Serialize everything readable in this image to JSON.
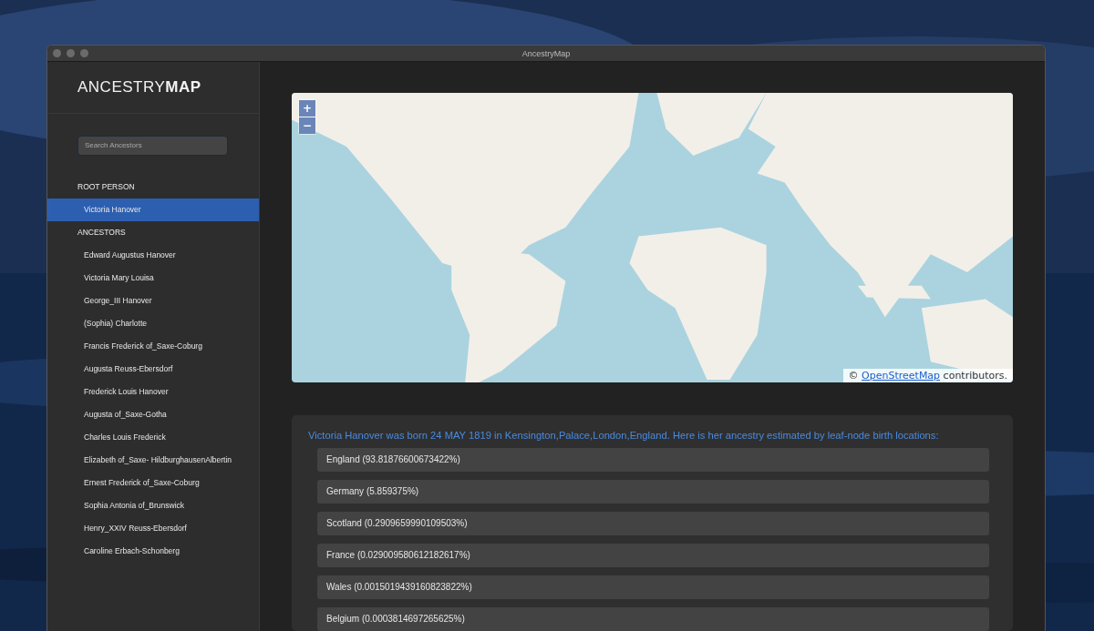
{
  "window": {
    "title": "AncestryMap"
  },
  "sidebar": {
    "logo": "ANCESTRY**MAP**",
    "search": {
      "placeholder": "Search Ancestors"
    },
    "sections": [
      {
        "heading": "ROOT PERSON",
        "items": [
          {
            "name": "Victoria Hanover",
            "selected": true
          }
        ]
      },
      {
        "heading": "ANCESTORS",
        "items": [
          {
            "name": "Edward Augustus Hanover",
            "selected": false
          },
          {
            "name": "Victoria Mary Louisa",
            "selected": false
          },
          {
            "name": "George_III Hanover",
            "selected": false
          },
          {
            "name": "(Sophia) Charlotte",
            "selected": false
          },
          {
            "name": "Francis Frederick of_Saxe-Coburg",
            "selected": false
          },
          {
            "name": "Augusta Reuss-Ebersdorf",
            "selected": false
          },
          {
            "name": "Frederick Louis Hanover",
            "selected": false
          },
          {
            "name": "Augusta of_Saxe-Gotha",
            "selected": false
          },
          {
            "name": "Charles Louis Frederick",
            "selected": false
          },
          {
            "name": "Elizabeth of_Saxe- HildburghausenAlbertin",
            "selected": false
          },
          {
            "name": "Ernest Frederick of_Saxe-Coburg",
            "selected": false
          },
          {
            "name": "Sophia Antonia of_Brunswick",
            "selected": false
          },
          {
            "name": "Henry_XXIV Reuss-Ebersdorf",
            "selected": false
          },
          {
            "name": "Caroline Erbach-Schonberg",
            "selected": false
          }
        ]
      }
    ]
  },
  "map": {
    "zoom_in": "+",
    "zoom_out": "−",
    "attribution": {
      "prefix": "©",
      "link": "OpenStreetMap",
      "suffix": "contributors."
    }
  },
  "results": {
    "summary": "Victoria Hanover was born 24 MAY 1819 in Kensington,Palace,London,England. Here is her ancestry estimated by leaf-node birth locations:",
    "rows": [
      "England (93.81876600673422%)",
      "Germany (5.859375%)",
      "Scotland (0.2909659990109503%)",
      "France (0.029009580612182617%)",
      "Wales (0.0015019439160823822%)",
      "Belgium (0.0003814697265625%)"
    ]
  }
}
